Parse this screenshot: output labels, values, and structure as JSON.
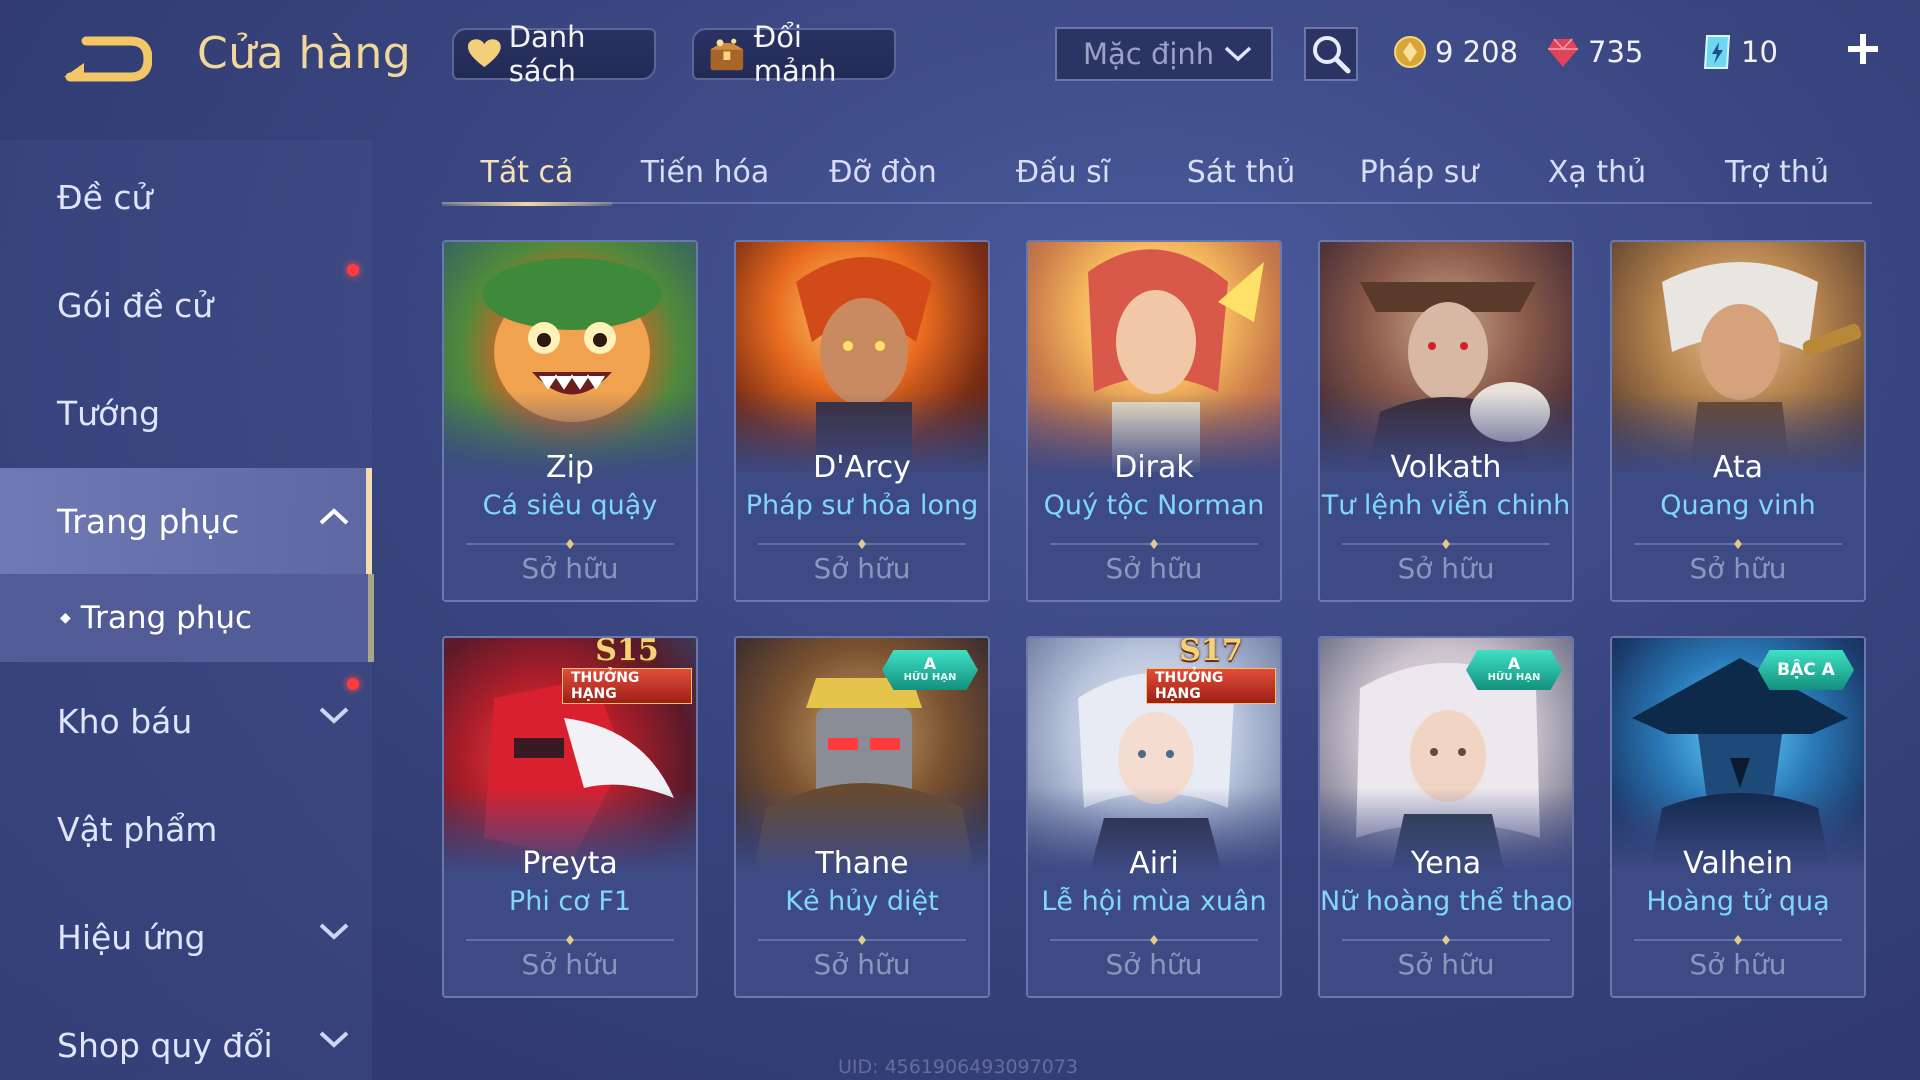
{
  "header": {
    "title": "Cửa hàng",
    "favorite_label": "Danh sách",
    "exchange_label": "Đổi mảnh",
    "sort_value": "Mặc định",
    "currencies": {
      "gold": "9 208",
      "ruby": "735",
      "voucher": "10"
    }
  },
  "sidebar": {
    "items": [
      {
        "label": "Đề cử"
      },
      {
        "label": "Gói đề cử"
      },
      {
        "label": "Tướng"
      },
      {
        "label": "Trang phục"
      },
      {
        "label": "Kho báu"
      },
      {
        "label": "Vật phẩm"
      },
      {
        "label": "Hiệu ứng"
      },
      {
        "label": "Shop quy đổi"
      }
    ],
    "sub_item": "Trang phục"
  },
  "tabs": [
    "Tất cả",
    "Tiến hóa",
    "Đỡ đòn",
    "Đấu sĩ",
    "Sát thủ",
    "Pháp sư",
    "Xạ thủ",
    "Trợ thủ"
  ],
  "cards": [
    {
      "hero": "Zip",
      "skin": "Cá siêu quậy",
      "status": "Sở hữu"
    },
    {
      "hero": "D'Arcy",
      "skin": "Pháp sư hỏa long",
      "status": "Sở hữu"
    },
    {
      "hero": "Dirak",
      "skin": "Quý tộc Norman",
      "status": "Sở hữu"
    },
    {
      "hero": "Volkath",
      "skin": "Tư lệnh viễn chinh",
      "status": "Sở hữu"
    },
    {
      "hero": "Ata",
      "skin": "Quang vinh",
      "status": "Sở hữu"
    },
    {
      "hero": "Preyta",
      "skin": "Phi cơ F1",
      "status": "Sở hữu",
      "badge_num": "S15",
      "badge_label": "THƯỞNG HẠNG"
    },
    {
      "hero": "Thane",
      "skin": "Kẻ hủy diệt",
      "status": "Sở hữu",
      "gem_top": "A",
      "gem_bottom": "HỮU HẠN"
    },
    {
      "hero": "Airi",
      "skin": "Lễ hội mùa xuân",
      "status": "Sở hữu",
      "badge_num": "S17",
      "badge_label": "THƯỞNG HẠNG"
    },
    {
      "hero": "Yena",
      "skin": "Nữ hoàng thể thao",
      "status": "Sở hữu",
      "gem_top": "A",
      "gem_bottom": "HỮU HẠN"
    },
    {
      "hero": "Valhein",
      "skin": "Hoàng tử quạ",
      "status": "Sở hữu",
      "gem_top": "BẬC A"
    }
  ],
  "footer": {
    "uid": "UID: 4561906493097073"
  },
  "colors": {
    "title_gold": "#f2d79a",
    "skin_name": "#7fd6ff",
    "owned_text": "#8c95bd",
    "notify_red": "#ff3b3b"
  },
  "icons": {
    "back": "back-arrow-icon",
    "favorite": "heart-icon",
    "exchange": "chest-icon",
    "sort": "chevron-down-icon",
    "search": "search-icon",
    "gold": "gold-coin-icon",
    "ruby": "ruby-gem-icon",
    "voucher": "voucher-icon",
    "add": "plus-icon"
  }
}
